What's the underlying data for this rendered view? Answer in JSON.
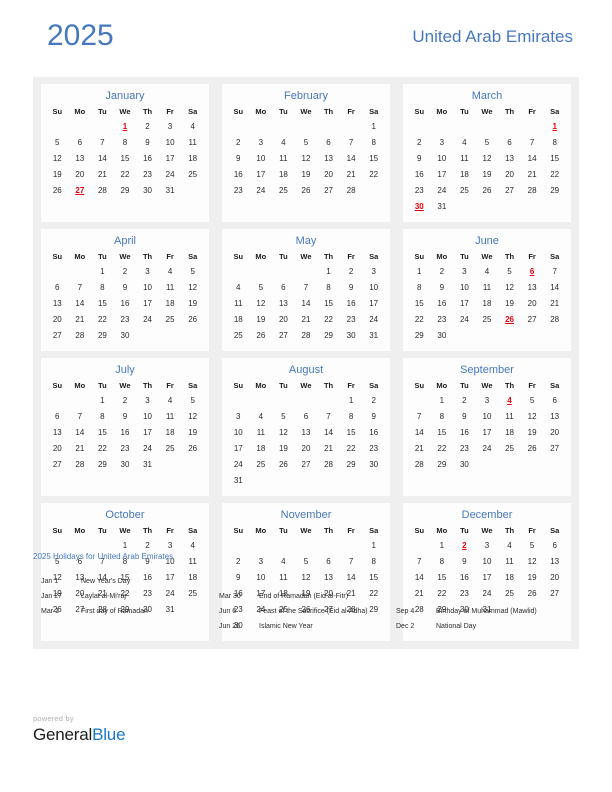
{
  "header": {
    "year": "2025",
    "country": "United Arab Emirates"
  },
  "colors": {
    "accent": "#4678c0",
    "holiday": "#e8000d",
    "panel": "#efeff0",
    "card": "#fdfdfd",
    "brand_blue": "#1878c8"
  },
  "weekdays": [
    "Su",
    "Mo",
    "Tu",
    "We",
    "Th",
    "Fr",
    "Sa"
  ],
  "months": [
    {
      "name": "January",
      "weeks": [
        [
          "",
          "",
          "",
          "1",
          "2",
          "3",
          "4"
        ],
        [
          "5",
          "6",
          "7",
          "8",
          "9",
          "10",
          "11"
        ],
        [
          "12",
          "13",
          "14",
          "15",
          "16",
          "17",
          "18"
        ],
        [
          "19",
          "20",
          "21",
          "22",
          "23",
          "24",
          "25"
        ],
        [
          "26",
          "27",
          "28",
          "29",
          "30",
          "31",
          ""
        ]
      ],
      "holidays": [
        "1",
        "27"
      ]
    },
    {
      "name": "February",
      "weeks": [
        [
          "",
          "",
          "",
          "",
          "",
          "",
          "1"
        ],
        [
          "2",
          "3",
          "4",
          "5",
          "6",
          "7",
          "8"
        ],
        [
          "9",
          "10",
          "11",
          "12",
          "13",
          "14",
          "15"
        ],
        [
          "16",
          "17",
          "18",
          "19",
          "20",
          "21",
          "22"
        ],
        [
          "23",
          "24",
          "25",
          "26",
          "27",
          "28",
          ""
        ]
      ],
      "holidays": []
    },
    {
      "name": "March",
      "weeks": [
        [
          "",
          "",
          "",
          "",
          "",
          "",
          "1"
        ],
        [
          "2",
          "3",
          "4",
          "5",
          "6",
          "7",
          "8"
        ],
        [
          "9",
          "10",
          "11",
          "12",
          "13",
          "14",
          "15"
        ],
        [
          "16",
          "17",
          "18",
          "19",
          "20",
          "21",
          "22"
        ],
        [
          "23",
          "24",
          "25",
          "26",
          "27",
          "28",
          "29"
        ],
        [
          "30",
          "31",
          "",
          "",
          "",
          "",
          ""
        ]
      ],
      "holidays": [
        "1",
        "30"
      ]
    },
    {
      "name": "April",
      "weeks": [
        [
          "",
          "",
          "1",
          "2",
          "3",
          "4",
          "5"
        ],
        [
          "6",
          "7",
          "8",
          "9",
          "10",
          "11",
          "12"
        ],
        [
          "13",
          "14",
          "15",
          "16",
          "17",
          "18",
          "19"
        ],
        [
          "20",
          "21",
          "22",
          "23",
          "24",
          "25",
          "26"
        ],
        [
          "27",
          "28",
          "29",
          "30",
          "",
          "",
          ""
        ]
      ],
      "holidays": []
    },
    {
      "name": "May",
      "weeks": [
        [
          "",
          "",
          "",
          "",
          "1",
          "2",
          "3"
        ],
        [
          "4",
          "5",
          "6",
          "7",
          "8",
          "9",
          "10"
        ],
        [
          "11",
          "12",
          "13",
          "14",
          "15",
          "16",
          "17"
        ],
        [
          "18",
          "19",
          "20",
          "21",
          "22",
          "23",
          "24"
        ],
        [
          "25",
          "26",
          "27",
          "28",
          "29",
          "30",
          "31"
        ]
      ],
      "holidays": []
    },
    {
      "name": "June",
      "weeks": [
        [
          "1",
          "2",
          "3",
          "4",
          "5",
          "6",
          "7"
        ],
        [
          "8",
          "9",
          "10",
          "11",
          "12",
          "13",
          "14"
        ],
        [
          "15",
          "16",
          "17",
          "18",
          "19",
          "20",
          "21"
        ],
        [
          "22",
          "23",
          "24",
          "25",
          "26",
          "27",
          "28"
        ],
        [
          "29",
          "30",
          "",
          "",
          "",
          "",
          ""
        ]
      ],
      "holidays": [
        "6",
        "26"
      ]
    },
    {
      "name": "July",
      "weeks": [
        [
          "",
          "",
          "1",
          "2",
          "3",
          "4",
          "5"
        ],
        [
          "6",
          "7",
          "8",
          "9",
          "10",
          "11",
          "12"
        ],
        [
          "13",
          "14",
          "15",
          "16",
          "17",
          "18",
          "19"
        ],
        [
          "20",
          "21",
          "22",
          "23",
          "24",
          "25",
          "26"
        ],
        [
          "27",
          "28",
          "29",
          "30",
          "31",
          "",
          ""
        ]
      ],
      "holidays": []
    },
    {
      "name": "August",
      "weeks": [
        [
          "",
          "",
          "",
          "",
          "",
          "1",
          "2"
        ],
        [
          "3",
          "4",
          "5",
          "6",
          "7",
          "8",
          "9"
        ],
        [
          "10",
          "11",
          "12",
          "13",
          "14",
          "15",
          "16"
        ],
        [
          "17",
          "18",
          "19",
          "20",
          "21",
          "22",
          "23"
        ],
        [
          "24",
          "25",
          "26",
          "27",
          "28",
          "29",
          "30"
        ],
        [
          "31",
          "",
          "",
          "",
          "",
          "",
          ""
        ]
      ],
      "holidays": []
    },
    {
      "name": "September",
      "weeks": [
        [
          "",
          "1",
          "2",
          "3",
          "4",
          "5",
          "6"
        ],
        [
          "7",
          "8",
          "9",
          "10",
          "11",
          "12",
          "13"
        ],
        [
          "14",
          "15",
          "16",
          "17",
          "18",
          "19",
          "20"
        ],
        [
          "21",
          "22",
          "23",
          "24",
          "25",
          "26",
          "27"
        ],
        [
          "28",
          "29",
          "30",
          "",
          "",
          "",
          ""
        ]
      ],
      "holidays": [
        "4"
      ]
    },
    {
      "name": "October",
      "weeks": [
        [
          "",
          "",
          "",
          "1",
          "2",
          "3",
          "4"
        ],
        [
          "5",
          "6",
          "7",
          "8",
          "9",
          "10",
          "11"
        ],
        [
          "12",
          "13",
          "14",
          "15",
          "16",
          "17",
          "18"
        ],
        [
          "19",
          "20",
          "21",
          "22",
          "23",
          "24",
          "25"
        ],
        [
          "26",
          "27",
          "28",
          "29",
          "30",
          "31",
          ""
        ]
      ],
      "holidays": []
    },
    {
      "name": "November",
      "weeks": [
        [
          "",
          "",
          "",
          "",
          "",
          "",
          "1"
        ],
        [
          "2",
          "3",
          "4",
          "5",
          "6",
          "7",
          "8"
        ],
        [
          "9",
          "10",
          "11",
          "12",
          "13",
          "14",
          "15"
        ],
        [
          "16",
          "17",
          "18",
          "19",
          "20",
          "21",
          "22"
        ],
        [
          "23",
          "24",
          "25",
          "26",
          "27",
          "28",
          "29"
        ],
        [
          "30",
          "",
          "",
          "",
          "",
          "",
          ""
        ]
      ],
      "holidays": []
    },
    {
      "name": "December",
      "weeks": [
        [
          "",
          "1",
          "2",
          "3",
          "4",
          "5",
          "6"
        ],
        [
          "7",
          "8",
          "9",
          "10",
          "11",
          "12",
          "13"
        ],
        [
          "14",
          "15",
          "16",
          "17",
          "18",
          "19",
          "20"
        ],
        [
          "21",
          "22",
          "23",
          "24",
          "25",
          "26",
          "27"
        ],
        [
          "28",
          "29",
          "30",
          "31",
          "",
          "",
          ""
        ]
      ],
      "holidays": [
        "2"
      ]
    }
  ],
  "holidays_section": {
    "title": "2025 Holidays for United Arab Emirates",
    "columns": [
      [
        {
          "date": "Jan 1",
          "name": "New Year's Day"
        },
        {
          "date": "Jan 27",
          "name": "Laylat al-Mi'raj"
        },
        {
          "date": "Mar 1",
          "name": "First day of Ramadan"
        }
      ],
      [
        {
          "date": "Mar 30",
          "name": "End of Ramadan (Eid al-Fitr)"
        },
        {
          "date": "Jun 6",
          "name": "Feast of the Sacrifice (Eid al-Adha)"
        },
        {
          "date": "Jun 26",
          "name": "Islamic New Year"
        }
      ],
      [
        {
          "date": "Sep 4",
          "name": "Birthday of Muhammad (Mawlid)"
        },
        {
          "date": "Dec 2",
          "name": "National Day"
        }
      ]
    ]
  },
  "footer": {
    "powered_by": "powered by",
    "brand_first": "General",
    "brand_second": "Blue"
  }
}
